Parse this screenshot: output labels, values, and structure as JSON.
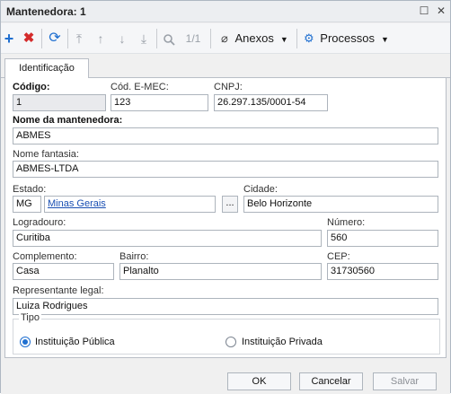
{
  "window": {
    "title": "Mantenedora: 1"
  },
  "toolbar": {
    "record_counter": "1/1",
    "anexos_label": "Anexos",
    "processos_label": "Processos"
  },
  "tabs": [
    {
      "label": "Identificação"
    }
  ],
  "form": {
    "codigo": {
      "label": "Código:",
      "value": "1"
    },
    "cod_emec": {
      "label": "Cód. E-MEC:",
      "value": "123"
    },
    "cnpj": {
      "label": "CNPJ:",
      "value": "26.297.135/0001-54"
    },
    "nome": {
      "label": "Nome da mantenedora:",
      "value": "ABMES"
    },
    "fantasia": {
      "label": "Nome fantasia:",
      "value": "ABMES-LTDA"
    },
    "estado": {
      "label": "Estado:",
      "uf": "MG",
      "name": "Minas Gerais",
      "browse": "..."
    },
    "cidade": {
      "label": "Cidade:",
      "value": "Belo Horizonte"
    },
    "logradouro": {
      "label": "Logradouro:",
      "value": "Curitiba"
    },
    "numero": {
      "label": "Número:",
      "value": "560"
    },
    "complemento": {
      "label": "Complemento:",
      "value": "Casa"
    },
    "bairro": {
      "label": "Bairro:",
      "value": "Planalto"
    },
    "cep": {
      "label": "CEP:",
      "value": "31730560"
    },
    "representante": {
      "label": "Representante legal:",
      "value": "Luiza Rodrigues"
    },
    "tipo": {
      "label": "Tipo",
      "options": [
        "Instituição Pública",
        "Instituição Privada"
      ],
      "selected": "Instituição Pública"
    }
  },
  "footer": {
    "ok": "OK",
    "cancel": "Cancelar",
    "save": "Salvar"
  },
  "colors": {
    "add": "#1f6fd0",
    "delete": "#d42b2b",
    "refresh": "#1f6fd0",
    "gear": "#1f6fd0",
    "link": "#1a4fb3"
  }
}
